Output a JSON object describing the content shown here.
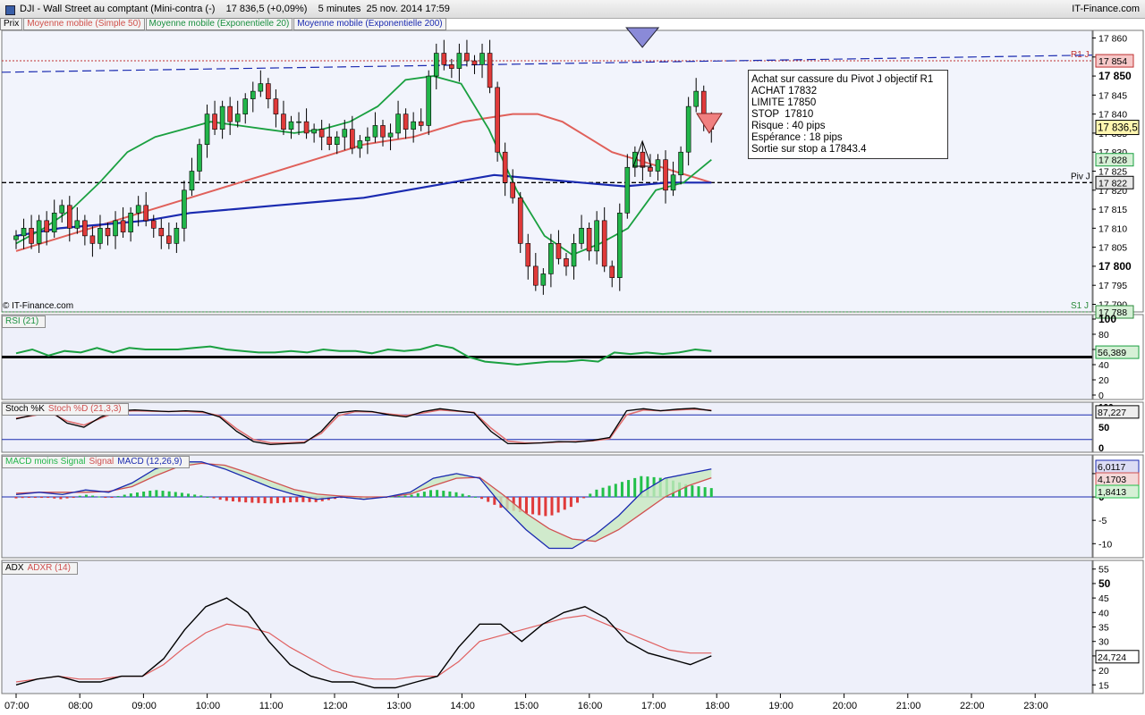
{
  "title": "DJI - Wall Street au comptant (Mini-contra (-)    17 836,5 (+0,09%)    5 minutes  25 nov. 2014 17:59",
  "brand": "IT-Finance.com",
  "copyright": "© IT-Finance.com",
  "legend": [
    "Prix",
    "Moyenne mobile (Simple 50)",
    "Moyenne mobile (Exponentielle 20)",
    "Moyenne mobile (Exponentielle 200)"
  ],
  "annotation": [
    "Achat sur cassure du Pivot J objectif R1",
    "ACHAT 17832",
    "LIMITE 17850",
    "STOP  17810",
    "Risque : 40 pips",
    "Espérance : 18 pips",
    "Sortie sur stop a 17843.4"
  ],
  "colors": {
    "up": "#22b64a",
    "down": "#e03a3a",
    "sma50": "#e0605a",
    "ema20": "#1aa040",
    "ema200": "#1a2ab0",
    "pivot": "#000000",
    "r1": "#c03030",
    "s1": "#2a8a3a"
  },
  "chart_data": [
    {
      "type": "candlestick",
      "panel": "price",
      "ylim": [
        17788,
        17862
      ],
      "yticks": [
        "17 860",
        "17 855",
        "17 850",
        "17 845",
        "17 840",
        "17 835",
        "17 830",
        "17 825",
        "17 820",
        "17 815",
        "17 810",
        "17 805",
        "17 800",
        "17 795",
        "17 790"
      ],
      "xticks": [
        "07:00",
        "08:00",
        "09:00",
        "10:00",
        "11:00",
        "12:00",
        "13:00",
        "14:00",
        "15:00",
        "16:00",
        "17:00",
        "18:00",
        "19:00",
        "20:00",
        "21:00",
        "22:00",
        "23:00"
      ],
      "levels": [
        {
          "name": "R1 J",
          "value": 17854,
          "tag": "17 854"
        },
        {
          "name": "Piv J",
          "value": 17822,
          "tag": "17 822"
        },
        {
          "name": "S1 J",
          "value": 17788,
          "tag": "17 788"
        }
      ],
      "last_price": "17 836,5",
      "ema20_value": "17 828",
      "candles_close": [
        17808,
        17810,
        17806,
        17812,
        17809,
        17814,
        17816,
        17810,
        17812,
        17808,
        17806,
        17810,
        17808,
        17812,
        17809,
        17814,
        17816,
        17812,
        17810,
        17808,
        17806,
        17810,
        17820,
        17825,
        17832,
        17840,
        17836,
        17842,
        17838,
        17840,
        17844,
        17846,
        17848,
        17844,
        17840,
        17836,
        17838,
        17838,
        17835,
        17836,
        17834,
        17832,
        17834,
        17836,
        17831,
        17833,
        17834,
        17837,
        17834,
        17835,
        17840,
        17836,
        17838,
        17837,
        17850,
        17856,
        17853,
        17852,
        17856,
        17854,
        17853,
        17856,
        17847,
        17830,
        17822,
        17818,
        17806,
        17800,
        17795,
        17798,
        17806,
        17802,
        17800,
        17806,
        17810,
        17804,
        17812,
        17800,
        17797,
        17814,
        17826,
        17830,
        17826,
        17825,
        17828,
        17820,
        17824,
        17830,
        17842,
        17846,
        17838,
        17836
      ],
      "sma50": [
        17804,
        17806,
        17808,
        17810,
        17812,
        17814,
        17816,
        17818,
        17820,
        17822,
        17824,
        17826,
        17828,
        17830,
        17832,
        17833,
        17834,
        17836,
        17838,
        17839,
        17840,
        17840,
        17838,
        17834,
        17830,
        17828,
        17826,
        17824,
        17822
      ],
      "ema20": [
        17806,
        17810,
        17815,
        17822,
        17830,
        17834,
        17836,
        17838,
        17837,
        17836,
        17835,
        17836,
        17838,
        17842,
        17849,
        17850,
        17848,
        17836,
        17820,
        17808,
        17803,
        17806,
        17810,
        17820,
        17822,
        17828
      ],
      "ema200": [
        17808,
        17810,
        17811,
        17812,
        17814,
        17815,
        17816,
        17817,
        17818,
        17820,
        17822,
        17824,
        17823,
        17822,
        17821,
        17822,
        17822
      ],
      "series": [
        {
          "name": "Moyenne mobile (Simple 50)"
        },
        {
          "name": "Moyenne mobile (Exponentielle 20)"
        },
        {
          "name": "Moyenne mobile (Exponentielle 200)"
        }
      ]
    },
    {
      "type": "line",
      "panel": "rsi",
      "title": "RSI (21)",
      "ylim": [
        0,
        100
      ],
      "yticks": [
        "100",
        "80",
        "60",
        "40",
        "20",
        "0"
      ],
      "level": 50,
      "last_value": "56,389",
      "values": [
        55,
        60,
        52,
        58,
        56,
        62,
        56,
        62,
        60,
        60,
        60,
        62,
        64,
        60,
        58,
        56,
        56,
        58,
        56,
        60,
        58,
        58,
        55,
        60,
        58,
        60,
        66,
        62,
        50,
        44,
        42,
        40,
        42,
        44,
        44,
        46,
        44,
        56,
        54,
        56,
        54,
        56,
        60,
        58
      ]
    },
    {
      "type": "line",
      "panel": "stochastic",
      "title": "Stoch %K",
      "series": [
        {
          "name": "Stoch %K"
        },
        {
          "name": "Stoch %D (21,3,3)"
        }
      ],
      "yticks": [
        "100",
        "50",
        "0"
      ],
      "levels": [
        80,
        20
      ],
      "last_value": "87,227",
      "k": [
        70,
        80,
        90,
        60,
        50,
        75,
        90,
        92,
        90,
        88,
        90,
        88,
        75,
        40,
        15,
        8,
        10,
        12,
        40,
        85,
        90,
        88,
        80,
        75,
        88,
        95,
        90,
        85,
        40,
        10,
        10,
        12,
        15,
        14,
        18,
        25,
        90,
        95,
        90,
        94,
        96,
        90
      ],
      "d": [
        72,
        78,
        86,
        65,
        55,
        72,
        88,
        90,
        89,
        88,
        89,
        86,
        78,
        46,
        20,
        12,
        12,
        14,
        35,
        78,
        88,
        87,
        82,
        78,
        85,
        92,
        89,
        86,
        48,
        16,
        12,
        12,
        14,
        15,
        17,
        22,
        80,
        92,
        90,
        92,
        94,
        91
      ]
    },
    {
      "type": "bar",
      "panel": "macd",
      "title": "MACD (12,26,9)",
      "series": [
        {
          "name": "MACD moins Signal"
        },
        {
          "name": "Signal"
        },
        {
          "name": "MACD (12,26,9)"
        }
      ],
      "yticks": [
        "5",
        "0",
        "-5",
        "-10"
      ],
      "last_values": [
        "6,0117",
        "4,1703",
        "1,8413"
      ],
      "macd": [
        0.5,
        1,
        0.5,
        1.5,
        1,
        3,
        6,
        7.5,
        7.5,
        6,
        4,
        2,
        0.5,
        -0.5,
        0,
        -0.5,
        0,
        1,
        4,
        5,
        4,
        -2,
        -7,
        -11,
        -11,
        -8,
        -4,
        1,
        4,
        5,
        6
      ],
      "signal": [
        0.8,
        1,
        1,
        1,
        1.2,
        2.2,
        4.5,
        6.5,
        7.2,
        6.8,
        5.2,
        3.4,
        1.6,
        0.6,
        0.2,
        0,
        0,
        0.6,
        2.4,
        4,
        4.2,
        0.5,
        -3.5,
        -6.8,
        -9,
        -9.5,
        -7,
        -3.5,
        0,
        2.4,
        4.1
      ],
      "histogram": [
        -0.3,
        0,
        -0.5,
        0.5,
        -0.2,
        0.8,
        1.5,
        1,
        0.3,
        -0.8,
        -1.2,
        -1.4,
        -1.1,
        -1.1,
        -0.2,
        -0.5,
        0,
        0.4,
        1.6,
        1,
        -0.2,
        -2.5,
        -3.5,
        -4.2,
        -2,
        1.5,
        3,
        4.5,
        4,
        2.6,
        1.9
      ]
    },
    {
      "type": "line",
      "panel": "adx",
      "title": "ADX",
      "series": [
        {
          "name": "ADX"
        },
        {
          "name": "ADXR (14)"
        }
      ],
      "yticks": [
        "55",
        "50",
        "45",
        "40",
        "35",
        "30",
        "25",
        "20",
        "15"
      ],
      "last_values": [
        "24,724"
      ],
      "adx": [
        15,
        17,
        18,
        16,
        16,
        18,
        18,
        24,
        34,
        42,
        45,
        40,
        30,
        22,
        18,
        16,
        16,
        14,
        14,
        16,
        18,
        28,
        36,
        36,
        30,
        36,
        40,
        42,
        38,
        30,
        26,
        24,
        22,
        25
      ],
      "adxr": [
        16,
        17,
        18,
        17,
        17,
        18,
        18,
        22,
        28,
        33,
        36,
        35,
        33,
        28,
        24,
        20,
        18,
        17,
        17,
        18,
        18,
        23,
        30,
        32,
        34,
        36,
        38,
        39,
        36,
        33,
        30,
        27,
        26,
        26
      ]
    }
  ]
}
